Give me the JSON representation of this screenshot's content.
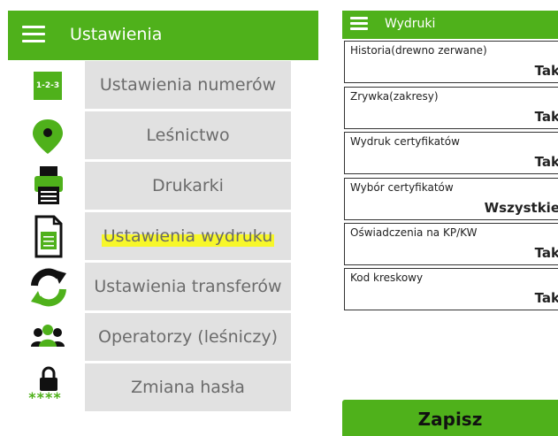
{
  "left_screen": {
    "title": "Ustawienia",
    "items": [
      {
        "label": "Ustawienia numerów",
        "icon": "numbers-123-icon",
        "icon_text": "1-2-3"
      },
      {
        "label": "Leśnictwo",
        "icon": "map-pin-icon"
      },
      {
        "label": "Drukarki",
        "icon": "printer-icon"
      },
      {
        "label": "Ustawienia wydruku",
        "icon": "document-icon",
        "highlighted": true
      },
      {
        "label": "Ustawienia transferów",
        "icon": "sync-arrows-icon"
      },
      {
        "label": "Operatorzy (leśniczy)",
        "icon": "people-icon"
      },
      {
        "label": "Zmiana hasła",
        "icon": "lock-password-icon",
        "icon_text": "****"
      }
    ]
  },
  "right_screen": {
    "title": "Wydruki",
    "fields": [
      {
        "label": "Historia(drewno zerwane)",
        "value": "Tak"
      },
      {
        "label": "Zrywka(zakresy)",
        "value": "Tak"
      },
      {
        "label": "Wydruk certyfikatów",
        "value": "Tak"
      },
      {
        "label": "Wybór certyfikatów",
        "value": "Wszystkie"
      },
      {
        "label": "Oświadczenia na KP/KW",
        "value": "Tak"
      },
      {
        "label": "Kod kreskowy",
        "value": "Tak"
      }
    ],
    "save_label": "Zapisz"
  },
  "colors": {
    "brand_green": "#4fb11b",
    "button_gray": "#e1e1e1",
    "highlight_yellow": "#f7f72a"
  }
}
